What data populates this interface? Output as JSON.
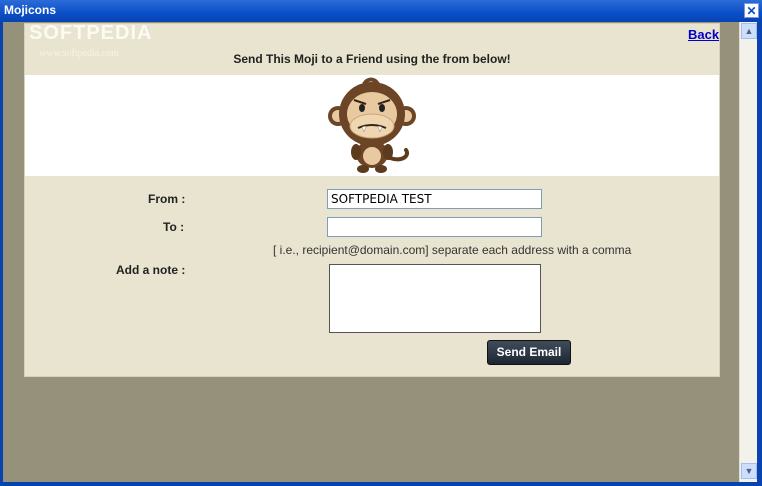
{
  "window": {
    "title": "Mojicons",
    "close_glyph": "✕"
  },
  "watermark": {
    "brand": "SOFTPEDIA",
    "url": "www.softpedia.com"
  },
  "nav": {
    "back_label": "Back"
  },
  "form": {
    "heading": "Send This Moji to a Friend using the from below!",
    "from_label": "From :",
    "from_value": "SOFTPEDIA TEST",
    "to_label": "To :",
    "to_value": "",
    "to_hint": "[ i.e., recipient@domain.com] separate each address with a comma",
    "note_label": "Add a note :",
    "note_value": "",
    "send_label": "Send Email"
  },
  "scrollbar": {
    "up_glyph": "▲",
    "down_glyph": "▼"
  },
  "colors": {
    "panel": "#e8e4cf",
    "background": "#96917a",
    "titlebar": "#0a4fc8",
    "send_button": "#1d2733"
  }
}
